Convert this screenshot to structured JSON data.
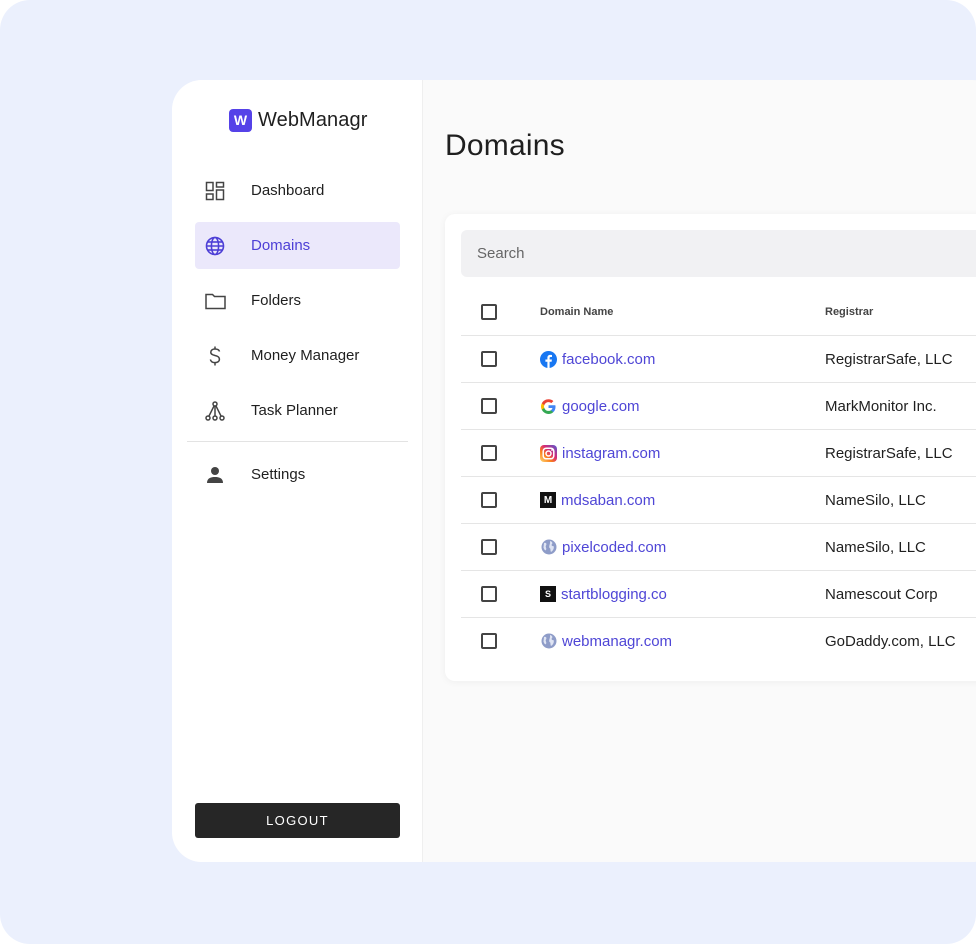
{
  "app": {
    "brand_letter": "W",
    "brand_name": "WebManagr",
    "accent": "#5542e8"
  },
  "sidebar": {
    "items": [
      {
        "label": "Dashboard",
        "icon": "dashboard-icon",
        "active": false
      },
      {
        "label": "Domains",
        "icon": "globe-icon",
        "active": true
      },
      {
        "label": "Folders",
        "icon": "folder-icon",
        "active": false
      },
      {
        "label": "Money Manager",
        "icon": "dollar-icon",
        "active": false
      },
      {
        "label": "Task Planner",
        "icon": "task-tree-icon",
        "active": false
      },
      {
        "label": "Settings",
        "icon": "person-icon",
        "active": false
      }
    ],
    "logout_label": "LOGOUT"
  },
  "main": {
    "title": "Domains",
    "search_placeholder": "Search",
    "columns": [
      "Domain Name",
      "Registrar"
    ],
    "rows": [
      {
        "domain": "facebook.com",
        "registrar": "RegistrarSafe, LLC",
        "favicon": "facebook-icon"
      },
      {
        "domain": "google.com",
        "registrar": "MarkMonitor Inc.",
        "favicon": "google-icon"
      },
      {
        "domain": "instagram.com",
        "registrar": "RegistrarSafe, LLC",
        "favicon": "instagram-icon"
      },
      {
        "domain": "mdsaban.com",
        "registrar": "NameSilo, LLC",
        "favicon": "m-logo-icon",
        "favicon_letter": "M"
      },
      {
        "domain": "pixelcoded.com",
        "registrar": "NameSilo, LLC",
        "favicon": "globe-icon"
      },
      {
        "domain": "startblogging.co",
        "registrar": "Namescout Corp",
        "favicon": "s-logo-icon",
        "favicon_letter": "S"
      },
      {
        "domain": "webmanagr.com",
        "registrar": "GoDaddy.com, LLC",
        "favicon": "globe-icon"
      }
    ]
  }
}
